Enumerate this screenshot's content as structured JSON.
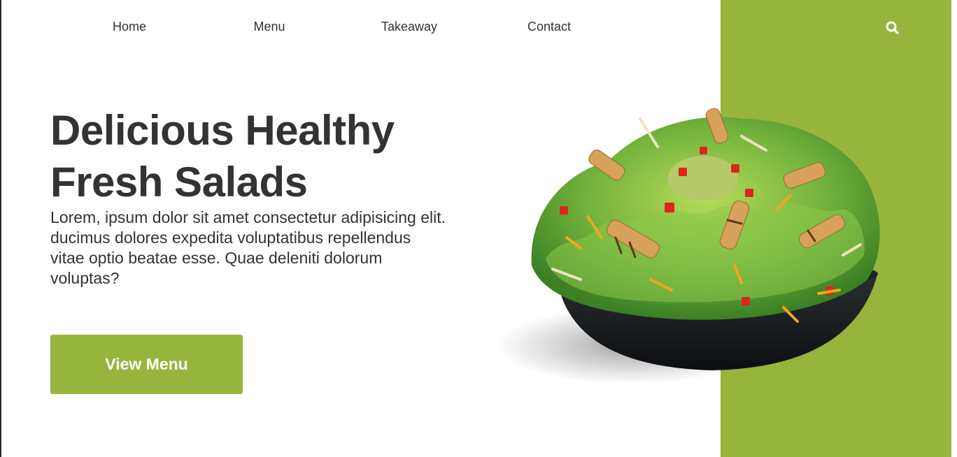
{
  "nav": {
    "items": [
      {
        "label": "Home"
      },
      {
        "label": "Menu"
      },
      {
        "label": "Takeaway"
      },
      {
        "label": "Contact"
      }
    ],
    "search_icon": "search-icon"
  },
  "hero": {
    "title_line1": "Delicious Healthy",
    "title_line2": "Fresh Salads",
    "description": "Lorem, ipsum dolor sit amet consectetur adipisicing elit. ducimus dolores expedita voluptatibus repellendus vitae optio beatae esse. Quae deleniti dolorum voluptas?",
    "cta_label": "View Menu",
    "image": "salad-bowl-image"
  },
  "colors": {
    "accent": "#97b43d",
    "text": "#333333",
    "background": "#ffffff"
  }
}
